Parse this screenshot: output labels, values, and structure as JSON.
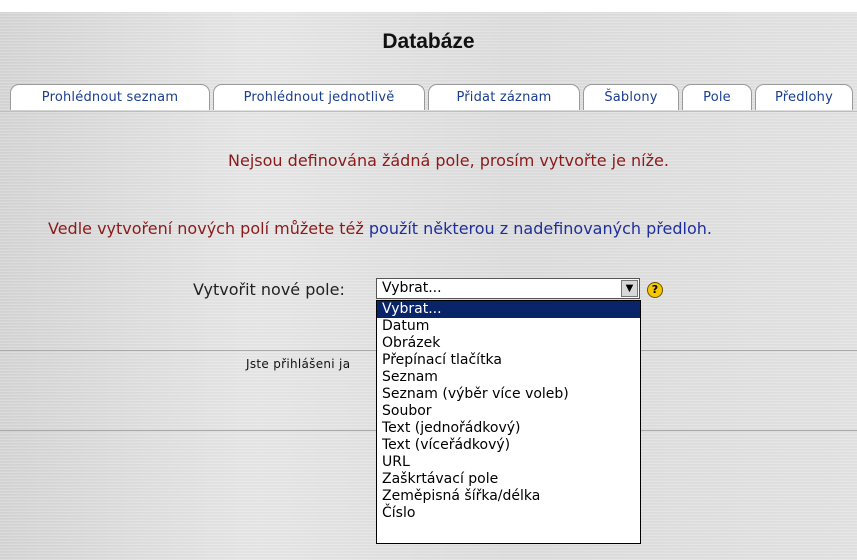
{
  "title": "Databáze",
  "tabs": [
    {
      "label": "Prohlédnout seznam"
    },
    {
      "label": "Prohlédnout jednotlivě"
    },
    {
      "label": "Přidat záznam"
    },
    {
      "label": "Šablony"
    },
    {
      "label": "Pole"
    },
    {
      "label": "Předlohy"
    }
  ],
  "messages": {
    "no_fields": "Nejsou definována žádná pole, prosím vytvořte je níže.",
    "presets_prefix": "Vedle vytvoření nových polí můžete též ",
    "presets_link": "použít některou z nadefinovaných předloh."
  },
  "new_field": {
    "label": "Vytvořit nové pole:",
    "selected": "Vybrat...",
    "help_icon": "question-icon",
    "options": [
      "Vybrat...",
      "Datum",
      "Obrázek",
      "Přepínací tlačítka",
      "Seznam",
      "Seznam (výběr více voleb)",
      "Soubor",
      "Text (jednořádkový)",
      "Text (víceřádkový)",
      "URL",
      "Zaškrtávací pole",
      "Zeměpisná šířka/délka",
      "Číslo"
    ]
  },
  "footer": {
    "login_text": "Jste přihlášeni ja"
  }
}
